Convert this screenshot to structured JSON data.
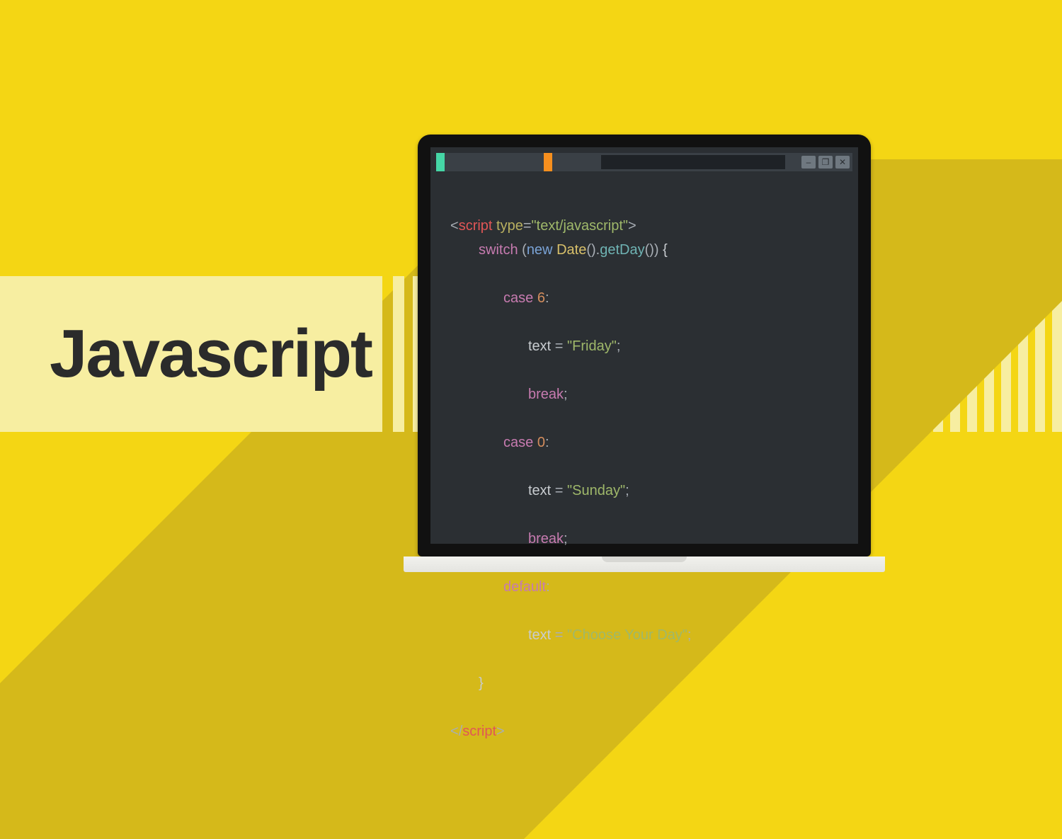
{
  "title": "Javascript",
  "window": {
    "minimize": "–",
    "maximize": "❐",
    "close": "✕"
  },
  "code": {
    "open_angle": "<",
    "close_angle": ">",
    "tag_script": "script",
    "attr_type": "type",
    "eq": "=",
    "mime": "\"text/javascript\"",
    "kw_switch": "switch",
    "paren_open": "(",
    "kw_new": "new",
    "class_date": "Date",
    "call_empty": "()",
    "dot": ".",
    "method_getday": "getDay",
    "paren_close": ")",
    "brace_open": " {",
    "kw_case": "case",
    "num_6": "6",
    "num_0": "0",
    "colon": ":",
    "var_text": "text",
    "assign": " = ",
    "str_friday": "\"Friday\"",
    "str_sunday": "\"Sunday\"",
    "str_choose": "\"Choose Your Day\"",
    "semi": ";",
    "kw_break": "break",
    "kw_default": "default",
    "brace_close": "}",
    "slash": "/"
  }
}
